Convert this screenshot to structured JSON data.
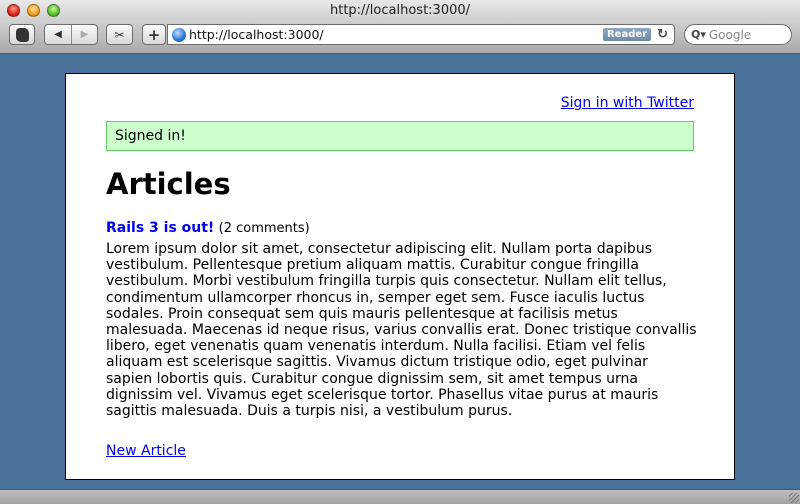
{
  "window": {
    "title": "http://localhost:3000/"
  },
  "toolbar": {
    "back_icon": "back-arrow-icon",
    "forward_icon": "forward-arrow-icon",
    "add_label": "+",
    "address": "http://localhost:3000/",
    "reader_label": "Reader",
    "search_placeholder": "Google"
  },
  "page": {
    "signin_link": "Sign in with Twitter",
    "flash_message": "Signed in!",
    "heading": "Articles",
    "articles": [
      {
        "title": "Rails 3 is out!",
        "comments": "(2 comments)",
        "body": "Lorem ipsum dolor sit amet, consectetur adipiscing elit. Nullam porta dapibus vestibulum. Pellentesque pretium aliquam mattis. Curabitur congue fringilla vestibulum. Morbi vestibulum fringilla turpis quis consectetur. Nullam elit tellus, condimentum ullamcorper rhoncus in, semper eget sem. Fusce iaculis luctus sodales. Proin consequat sem quis mauris pellentesque at facilisis metus malesuada. Maecenas id neque risus, varius convallis erat. Donec tristique convallis libero, eget venenatis quam venenatis interdum. Nulla facilisi. Etiam vel felis aliquam est scelerisque sagittis. Vivamus dictum tristique odio, eget pulvinar sapien lobortis quis. Curabitur congue dignissim sem, sit amet tempus urna dignissim vel. Vivamus eget scelerisque tortor. Phasellus vitae purus at mauris sagittis malesuada. Duis a turpis nisi, a vestibulum purus."
      }
    ],
    "new_article_link": "New Article"
  }
}
